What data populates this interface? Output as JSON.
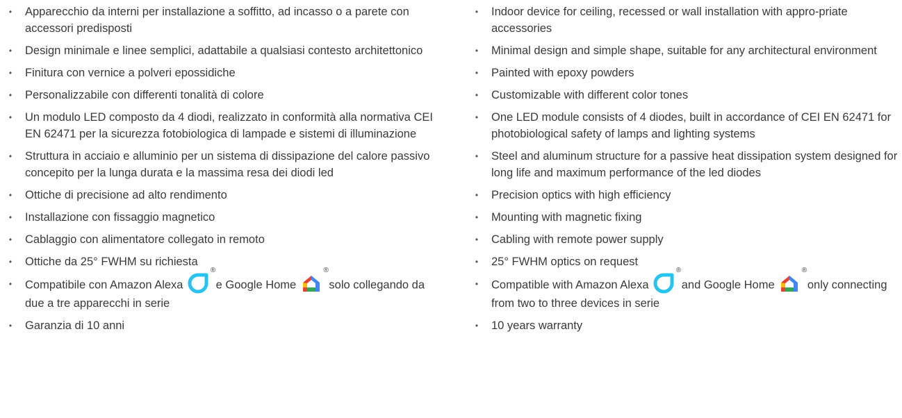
{
  "it": {
    "items": [
      "Apparecchio da interni per installazione a soffitto, ad incasso o a parete con accessori predisposti",
      "Design minimale e linee semplici, adattabile a qualsiasi contesto architettonico",
      "Finitura con vernice a polveri epossidiche",
      "Personalizzabile con differenti tonalità di colore",
      "Un modulo LED composto da 4 diodi, realizzato in conformità alla normativa CEI EN 62471 per la sicurezza fotobiologica di lampade e sistemi di illuminazione",
      "Struttura in acciaio e alluminio per un sistema di dissipazione del calore passivo concepito per la lunga durata e la massima resa dei diodi led",
      "Ottiche di precisione ad alto rendimento",
      "Installazione con fissaggio magnetico",
      "Cablaggio con alimentatore collegato in remoto",
      "Ottiche da 25° FWHM su richiesta"
    ],
    "compat": {
      "before": "Compatibile con Amazon Alexa",
      "middle": "e Google Home",
      "after": "solo collegando da due a tre apparecchi in serie"
    },
    "last": "Garanzia di 10 anni"
  },
  "en": {
    "items": [
      "Indoor device for ceiling, recessed or wall installation with appro-priate accessories",
      "Minimal design and simple shape, suitable for any architectural environment",
      "Painted with epoxy powders",
      "Customizable with different color tones",
      "One LED module consists of 4 diodes, built in accordance of CEI EN 62471 for photobiological safety of lamps and lighting systems",
      "Steel and aluminum structure for a passive heat dissipation system designed for long life and maximum performance of the led diodes",
      "Precision optics with high efficiency",
      "Mounting with magnetic fixing",
      "Cabling with remote power supply",
      "25° FWHM optics on request"
    ],
    "compat": {
      "before": "Compatible with Amazon Alexa",
      "middle": "and Google Home",
      "after": "only connecting from two to three devices in serie"
    },
    "last": "10 years warranty"
  },
  "symbols": {
    "bullet": "•",
    "registered": "®"
  },
  "icons": {
    "alexa": "amazon-alexa-icon",
    "google_home": "google-home-icon"
  },
  "colors": {
    "text": "#3a3a3a",
    "alexa": "#27c4f2",
    "gh_red": "#ea4335",
    "gh_yellow": "#fbbc05",
    "gh_green": "#34a853",
    "gh_blue": "#4285f4"
  }
}
